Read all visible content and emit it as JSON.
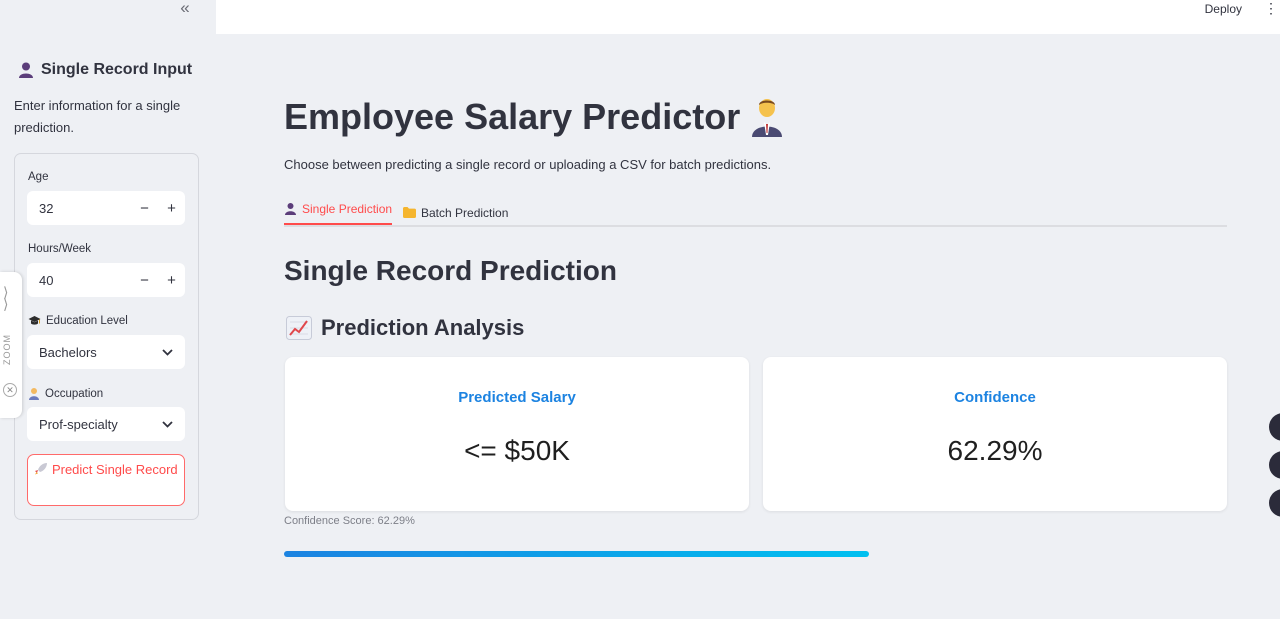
{
  "sidebar": {
    "collapse_icon": "«",
    "title": "Single Record Input",
    "title_icon": "person-silhouette-icon",
    "description": "Enter information for a single prediction.",
    "fields": {
      "age": {
        "label": "Age",
        "value": "32"
      },
      "hours": {
        "label": "Hours/Week",
        "value": "40"
      },
      "education": {
        "label": "Education Level",
        "value": "Bachelors",
        "icon": "graduation-cap-icon"
      },
      "occupation": {
        "label": "Occupation",
        "value": "Prof-specialty",
        "icon": "office-worker-icon"
      }
    },
    "predict_button": "Predict Single Record",
    "predict_icon": "rocket-icon"
  },
  "zoom_widget": {
    "label": "ZOOM"
  },
  "header": {
    "deploy_label": "Deploy",
    "menu_icon": "⋮"
  },
  "main": {
    "title": "Employee Salary Predictor",
    "title_icon": "man-office-worker-icon",
    "description": "Choose between predicting a single record or uploading a CSV for batch predictions.",
    "tabs": [
      {
        "label": "Single Prediction",
        "icon": "person-silhouette-icon",
        "active": true
      },
      {
        "label": "Batch Prediction",
        "icon": "folder-icon",
        "active": false
      }
    ],
    "section_title": "Single Record Prediction",
    "analysis_title": "Prediction Analysis",
    "analysis_icon": "chart-increasing-icon",
    "cards": [
      {
        "label": "Predicted Salary",
        "value": "<= $50K"
      },
      {
        "label": "Confidence",
        "value": "62.29%"
      }
    ],
    "confidence_score_text": "Confidence Score: 62.29%",
    "progress_fraction": 0.6229
  },
  "colors": {
    "accent": "#ff4b4b",
    "card_label": "#1c83e1",
    "progress_start": "#1c83e1",
    "progress_end": "#00c0f0"
  }
}
